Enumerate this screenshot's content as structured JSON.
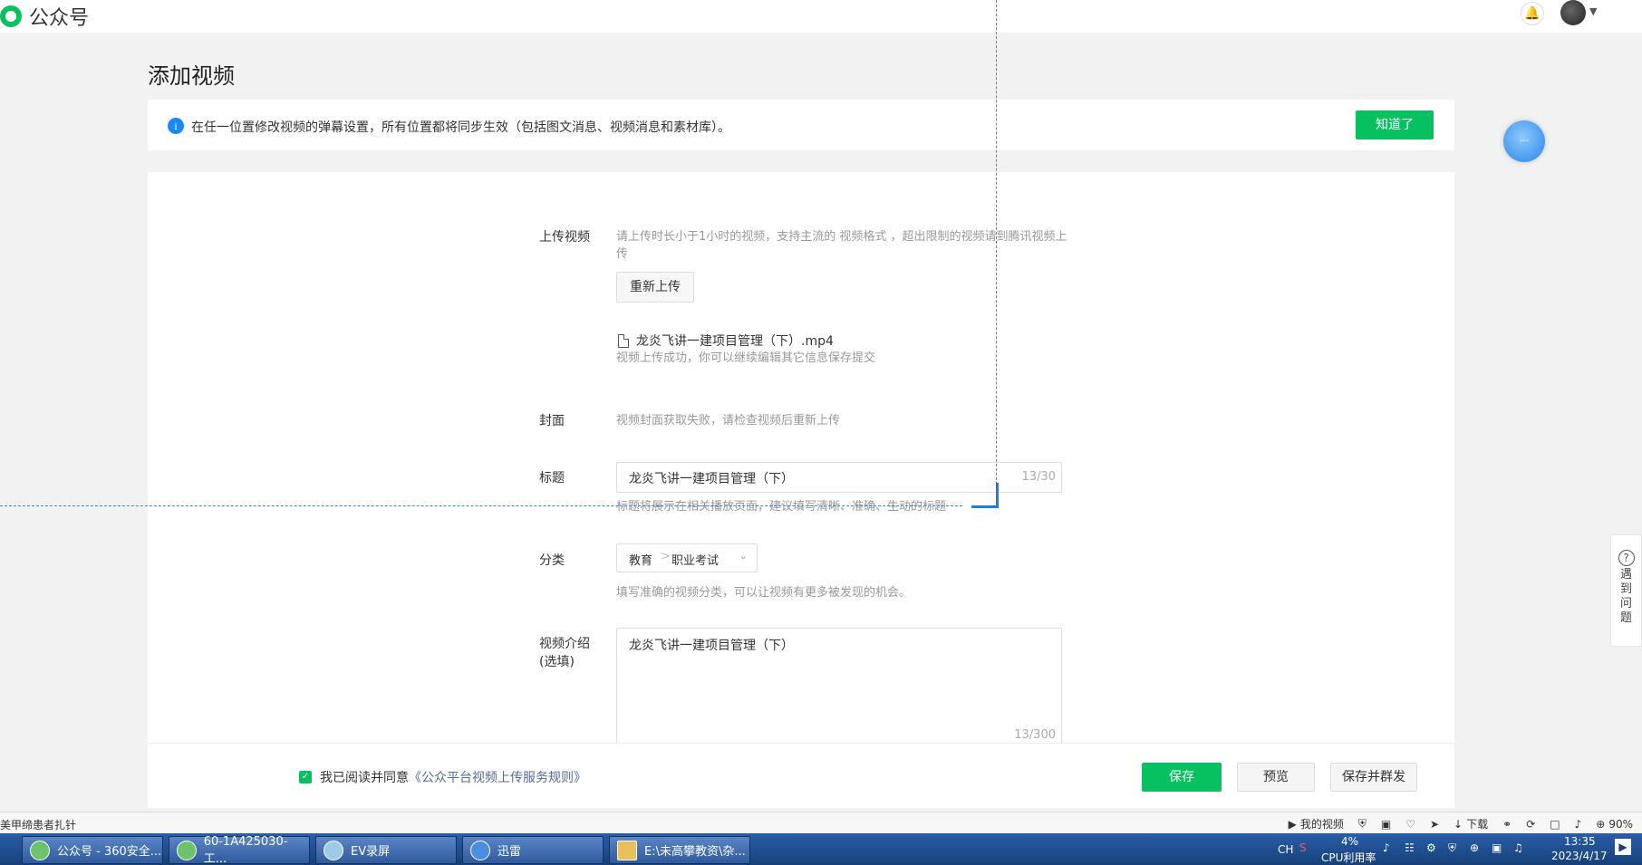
{
  "header": {
    "logo_text": "公众号"
  },
  "page": {
    "title": "添加视频"
  },
  "notice": {
    "text": "在任一位置修改视频的弹幕设置，所有位置都将同步生效（包括图文消息、视频消息和素材库）。",
    "button": "知道了"
  },
  "form": {
    "upload": {
      "label": "上传视频",
      "hint_line1": "请上传时长小于1小时的视频，支持主流的 视频格式 ，超出限制的视频请到腾讯视频上",
      "hint_line2": "传",
      "reupload_button": "重新上传",
      "file_name": "龙炎飞讲一建项目管理（下）.mp4",
      "success_text": "视频上传成功，你可以继续编辑其它信息保存提交"
    },
    "cover": {
      "label": "封面",
      "hint": "视频封面获取失败，请检查视频后重新上传"
    },
    "title": {
      "label": "标题",
      "value": "龙炎飞讲一建项目管理（下）",
      "count": "13/30",
      "hint": "标题将展示在相关播放页面，建议填写清晰、准确、生动的标题"
    },
    "category": {
      "label": "分类",
      "level1": "教育",
      "separator": ">",
      "level2": "职业考试",
      "hint": "填写准确的视频分类，可以让视频有更多被发现的机会。"
    },
    "intro": {
      "label_line1": "视频介绍",
      "label_line2": "(选填)",
      "value": "龙炎飞讲一建项目管理（下）",
      "count": "13/300"
    }
  },
  "actions": {
    "agree_text": "我已阅读并同意",
    "agree_link": "《公众平台视频上传服务规则》",
    "save": "保存",
    "preview": "预览",
    "save_and_send": "保存并群发"
  },
  "help": {
    "text": "遇到问题"
  },
  "statusbar": {
    "left_text": "美甲缔患者扎针",
    "my_video": "我的视频",
    "download": "下载",
    "zoom": "90%"
  },
  "taskbar": {
    "tasks": [
      "公众号 - 360安全...",
      "60-1A425030-工...",
      "EV录屏",
      "迅雷",
      "E:\\未高攀教资\\杂..."
    ],
    "lang": "CH",
    "cpu_percent": "4%",
    "cpu_label": "CPU利用率",
    "time": "13:35",
    "date": "2023/4/17"
  },
  "colors": {
    "primary_green": "#07c160",
    "info_blue": "#1989fa",
    "link": "#576b95",
    "guide_blue": "#3a8ad9"
  }
}
